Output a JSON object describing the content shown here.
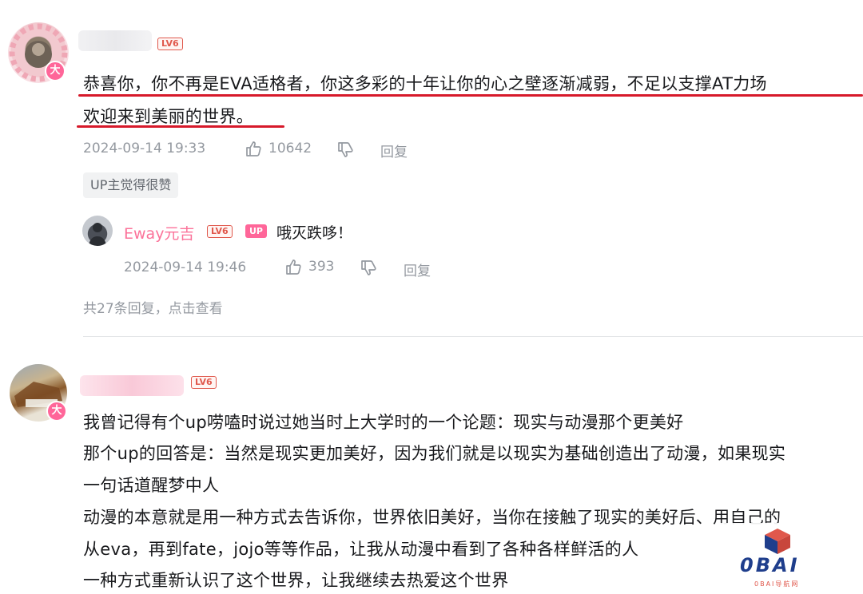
{
  "comment1": {
    "level_badge": "LV6",
    "vip_badge": "大",
    "text_lines": [
      "恭喜你，你不再是EVA适格者，你这多彩的十年让你的心之壁逐渐减弱，不足以支撑AT力场",
      "欢迎来到美丽的世界。"
    ],
    "time": "2024-09-14 19:33",
    "likes": "10642",
    "reply_label": "回复",
    "up_liked_chip": "UP主觉得很赞"
  },
  "reply1": {
    "name": "Eway元吉",
    "level_badge": "LV6",
    "up_badge": "UP",
    "text": "哦灭跌哆！",
    "time": "2024-09-14 19:46",
    "likes": "393",
    "reply_label": "回复"
  },
  "comment1_more": "共27条回复，点击查看",
  "comment2": {
    "level_badge": "LV6",
    "vip_badge": "大",
    "text_lines": [
      "我曾记得有个up唠嗑时说过她当时上大学时的一个论题：现实与动漫那个更美好",
      "那个up的回答是：当然是现实更加美好，因为我们就是以现实为基础创造出了动漫，如果现实",
      "一句话道醒梦中人",
      "动漫的本意就是用一种方式去告诉你，世界依旧美好，当你在接触了现实的美好后、用自己的",
      "从eva，再到fate，jojo等等作品，让我从动漫中看到了各种各样鲜活的人",
      "一种方式重新认识了这个世界，让我继续去热爱这个世界"
    ]
  },
  "watermark": {
    "logo_text": "0BAI",
    "sub_text": "0BAI导航网"
  },
  "colors": {
    "accent_pink": "#fb7299",
    "underline_red": "#d7192a",
    "level_red": "#e0584c",
    "meta_gray": "#9499a0"
  }
}
